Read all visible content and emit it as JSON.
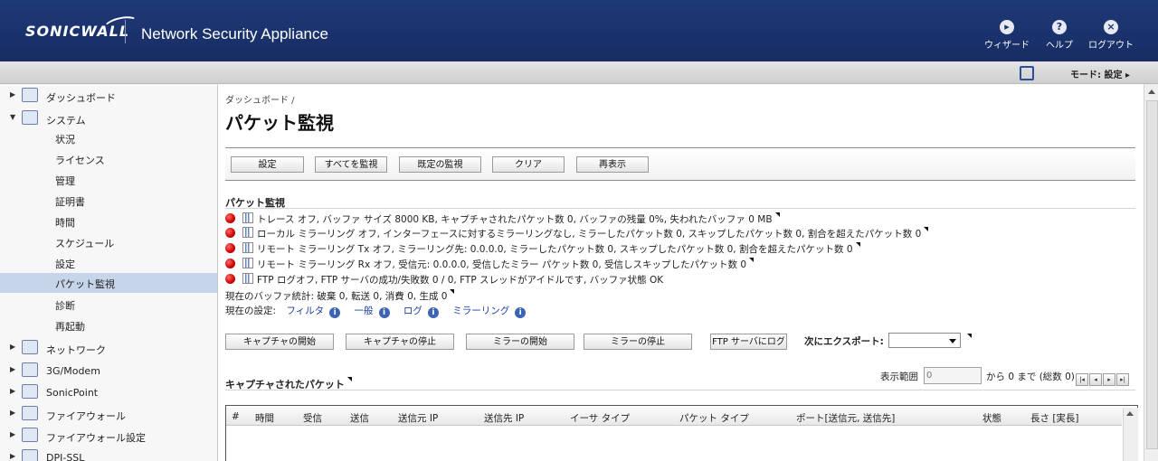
{
  "header": {
    "logo": "SONICWALL",
    "product": "Network Security Appliance",
    "buttons": [
      {
        "label": "ウィザード",
        "icon": "wizard-icon"
      },
      {
        "label": "ヘルプ",
        "icon": "help-icon"
      },
      {
        "label": "ログアウト",
        "icon": "logout-icon"
      }
    ]
  },
  "modebar": {
    "mode": "モード:  設定  ▸"
  },
  "sidebar": {
    "top": [
      {
        "label": "ダッシュボード",
        "arrow": "▶"
      },
      {
        "label": "システム",
        "arrow": "▼"
      }
    ],
    "system_items": [
      "状況",
      "ライセンス",
      "管理",
      "証明書",
      "時間",
      "スケジュール",
      "設定",
      "パケット監視",
      "診断",
      "再起動"
    ],
    "bottom": [
      {
        "label": "ネットワーク",
        "arrow": "▶"
      },
      {
        "label": "3G/Modem",
        "arrow": "▶"
      },
      {
        "label": "SonicPoint",
        "arrow": "▶"
      },
      {
        "label": "ファイアウォール",
        "arrow": "▶"
      },
      {
        "label": "ファイアウォール設定",
        "arrow": "▶"
      },
      {
        "label": "DPI-SSL",
        "arrow": "▶"
      }
    ]
  },
  "main": {
    "breadcrumb": "ダッシュボード  /",
    "title": "パケット監視",
    "toolbar": [
      "設定",
      "すべてを監視",
      "既定の監視",
      "クリア",
      "再表示"
    ],
    "section_title": "パケット監視",
    "status": [
      "トレース オフ,  バッファ サイズ 8000 KB,   キャプチャされたパケット数 0,   バッファの残量 0%,   失われたバッファ 0 MB",
      "ローカル ミラーリング オフ,  インターフェースに対するミラーリングなし, ミラーしたパケット数 0,   スキップしたパケット数 0,   割合を超えたパケット数 0",
      "リモート ミラーリング Tx オフ,  ミラーリング先: 0.0.0.0,  ミラーしたパケット数 0,   スキップしたパケット数 0,   割合を超えたパケット数 0",
      "リモート ミラーリング Rx オフ,  受信元: 0.0.0.0,  受信したミラー パケット数 0,   受信しスキップしたパケット数 0",
      "FTP ログオフ,  FTP サーバの成功/失敗数 0 / 0,  FTP スレッドがアイドルです,  バッファ状態 OK"
    ],
    "buffer_stats": "現在のバッファ統計:  破棄 0, 転送 0, 消費 0, 生成 0",
    "settings_label": "現在の設定:",
    "settings_links": [
      "フィルタ",
      "一般",
      "ログ",
      "ミラーリング"
    ],
    "actions": [
      "キャプチャの開始",
      "キャプチャの停止",
      "ミラーの開始",
      "ミラーの停止",
      "FTP サーバにログ"
    ],
    "export_label": "次にエクスポート:",
    "captured_title": "キャプチャされたパケット",
    "range_label": "表示範囲",
    "range_value": "0",
    "range_suffix": "から 0 まで (総数 0)",
    "pager": [
      "|◂",
      "◂",
      "▸",
      "▸|"
    ],
    "columns": [
      "#",
      "時間",
      "受信",
      "送信",
      "送信元 IP",
      "送信先 IP",
      "イーサ タイプ",
      "パケット タイプ",
      "ポート[送信元, 送信先]",
      "状態",
      "長さ [実長]"
    ]
  },
  "colors": {
    "header": "#1f3a78",
    "active_nav": "#c6d5ea",
    "status_dot": "#cc0000",
    "link": "#1a3fa0"
  }
}
